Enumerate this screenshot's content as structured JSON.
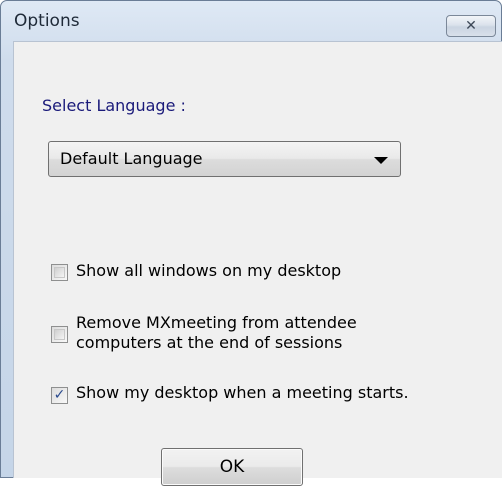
{
  "window": {
    "title": "Options",
    "close_glyph": "✕"
  },
  "language": {
    "label": "Select Language :",
    "selected": "Default Language"
  },
  "checkboxes": [
    {
      "label_lines": [
        "Show all windows on my desktop"
      ],
      "checked": false
    },
    {
      "label_lines": [
        "Remove MXmeeting from attendee",
        "computers at the end of sessions"
      ],
      "checked": false
    },
    {
      "label_lines": [
        "Show my desktop when a meeting starts."
      ],
      "checked": true,
      "mark": "✓"
    }
  ],
  "buttons": {
    "ok_label": "OK"
  },
  "colors": {
    "titlebar": "#cfdcec",
    "client": "#f0f0f0",
    "label_accent": "#1a1a7a",
    "check": "#2a4a8e"
  }
}
